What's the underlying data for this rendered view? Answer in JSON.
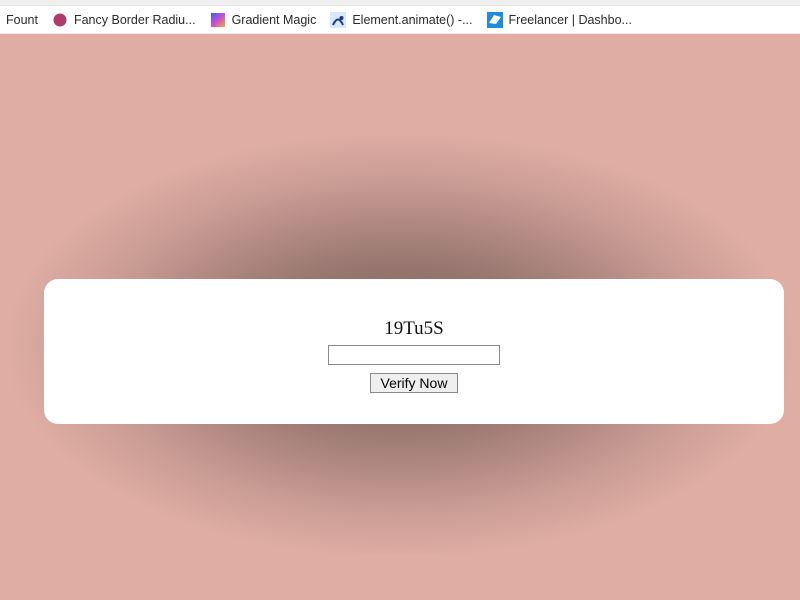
{
  "bookmarks": [
    {
      "label": "Fount",
      "icon": "generic"
    },
    {
      "label": "Fancy Border Radiu...",
      "icon": "fancy"
    },
    {
      "label": "Gradient Magic",
      "icon": "gradient"
    },
    {
      "label": "Element.animate() -...",
      "icon": "animate"
    },
    {
      "label": "Freelancer | Dashbo...",
      "icon": "freelancer"
    }
  ],
  "captcha": {
    "code": "19Tu5S",
    "input_value": "",
    "button_label": "Verify Now"
  },
  "colors": {
    "page_bg": "#dfada4",
    "card_bg": "#ffffff"
  }
}
